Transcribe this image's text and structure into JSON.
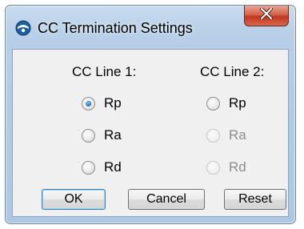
{
  "window": {
    "title": "CC Termination Settings",
    "close_glyph": "X"
  },
  "line1": {
    "header": "CC Line 1:",
    "options": [
      {
        "label": "Rp",
        "selected": true,
        "enabled": true
      },
      {
        "label": "Ra",
        "selected": false,
        "enabled": true
      },
      {
        "label": "Rd",
        "selected": false,
        "enabled": true
      }
    ]
  },
  "line2": {
    "header": "CC Line 2:",
    "options": [
      {
        "label": "Rp",
        "selected": false,
        "enabled": true
      },
      {
        "label": "Ra",
        "selected": false,
        "enabled": false
      },
      {
        "label": "Rd",
        "selected": false,
        "enabled": false
      }
    ]
  },
  "buttons": {
    "ok": "OK",
    "cancel": "Cancel",
    "reset": "Reset"
  },
  "colors": {
    "titlebar": "#b7cfe7",
    "close_button": "#c1371f",
    "client_bg": "#f0f0f0",
    "radio_selected": "#1c6eb5"
  },
  "icons": {
    "app": "round-app-icon",
    "close": "close-x-icon"
  }
}
